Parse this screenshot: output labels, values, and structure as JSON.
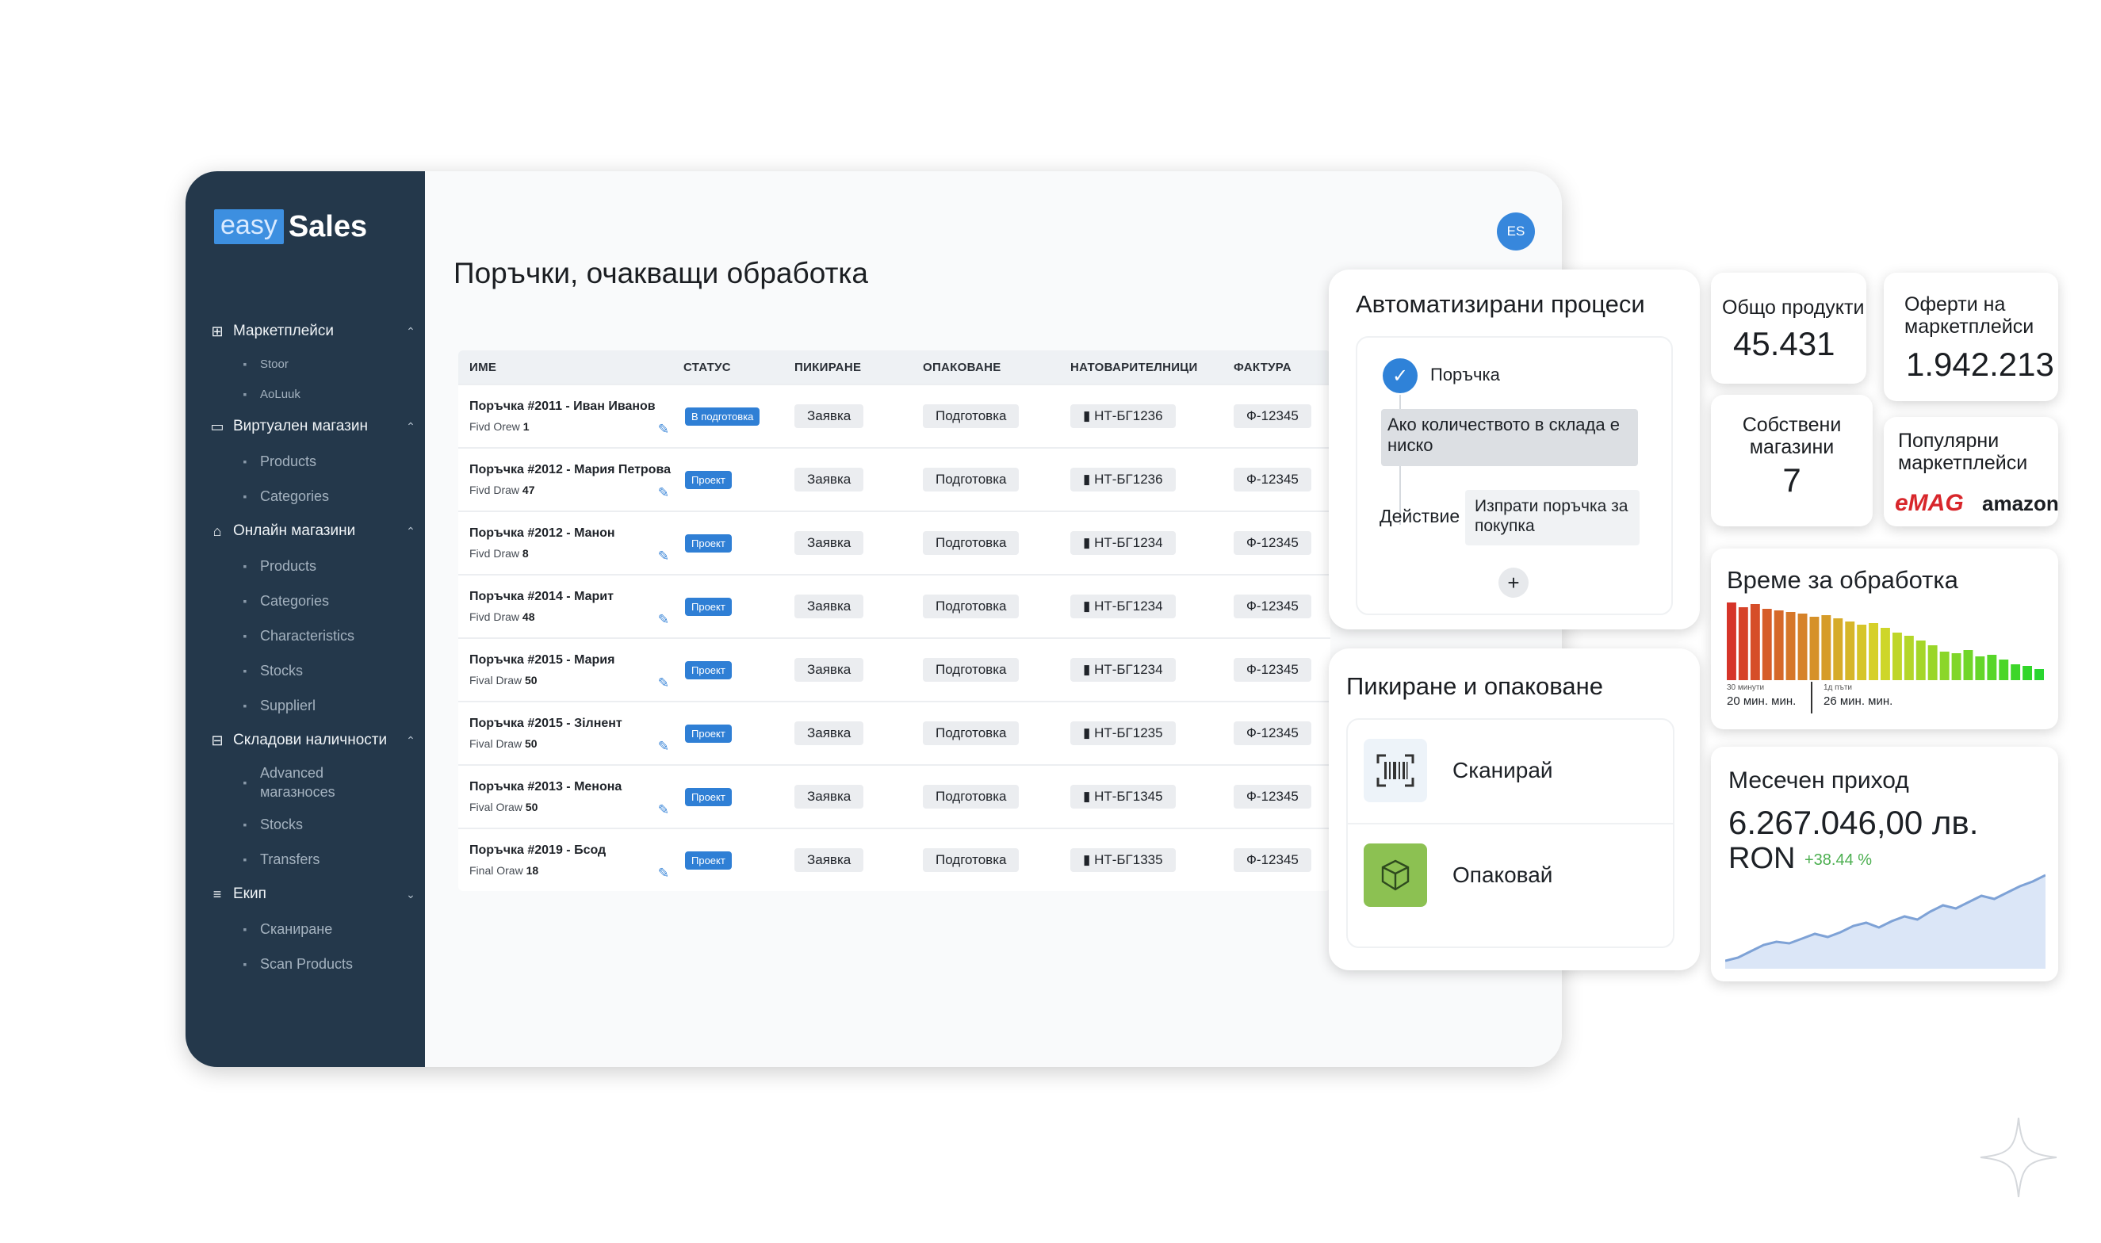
{
  "brand": {
    "easy": "easy",
    "sales": "Sales"
  },
  "user": {
    "initials": "ES"
  },
  "sidebar": {
    "groups": [
      {
        "icon": "marketplace-icon",
        "label": "Маркетплейси",
        "items": [
          {
            "icon": "stor-icon",
            "label": "Stoor"
          },
          {
            "icon": "aduuk-icon",
            "label": "AoLuuk"
          }
        ]
      },
      {
        "icon": "virtual-store-icon",
        "label": "Виртуален магазин",
        "items": [
          {
            "icon": "products-icon",
            "label": "Products"
          },
          {
            "icon": "categories-icon",
            "label": "Categories"
          }
        ]
      },
      {
        "icon": "online-store-icon",
        "label": "Онлайн магазини",
        "items": [
          {
            "icon": "cart-icon",
            "label": "Products"
          },
          {
            "icon": "categories-icon",
            "label": "Categories"
          },
          {
            "icon": "characteristics-icon",
            "label": "Characteristics"
          },
          {
            "icon": "stocks-icon",
            "label": "Stocks"
          },
          {
            "icon": "supplier-icon",
            "label": "Supplierl"
          }
        ]
      },
      {
        "icon": "warehouse-icon",
        "label": "Складови наличности",
        "items": [
          {
            "icon": "advanced-icon",
            "label": "Advanced магазносеs"
          },
          {
            "icon": "stocks-icon",
            "label": "Stocks"
          },
          {
            "icon": "transfers-icon",
            "label": "Transfers"
          }
        ]
      },
      {
        "icon": "team-icon",
        "label": "Екип",
        "items": [
          {
            "icon": "scan-icon",
            "label": "Сканиране"
          },
          {
            "icon": "scan-products-icon",
            "label": "Scan Products"
          }
        ]
      }
    ]
  },
  "main": {
    "title": "Поръчки, очакващи обработка",
    "columns": [
      "ИМЕ",
      "СТАТУС",
      "ПИКИРАНЕ",
      "ОПАКОВАНЕ",
      "НАТОВАРИТЕЛНИЦИ",
      "ФАКТУРА"
    ],
    "rows": [
      {
        "name": "Поръчка #2011 - Иван Иванов",
        "sub_label": "Fivd Orew",
        "sub_value": "1",
        "status": "В подготовка",
        "picking": "Заявка",
        "packing": "Подготовка",
        "waybill": "НТ-БГ1236",
        "invoice": "Ф-12345"
      },
      {
        "name": "Поръчка #2012 - Мария Петрова",
        "sub_label": "Fivd Draw",
        "sub_value": "47",
        "status": "Проект",
        "picking": "Заявка",
        "packing": "Подготовка",
        "waybill": "НТ-БГ1236",
        "invoice": "Ф-12345"
      },
      {
        "name": "Поръчка #2012 - Манон",
        "sub_label": "Fivd Draw",
        "sub_value": "8",
        "status": "Проект",
        "picking": "Заявка",
        "packing": "Подготовка",
        "waybill": "НТ-БГ1234",
        "invoice": "Ф-12345"
      },
      {
        "name": "Поръчка #2014 - Марит",
        "sub_label": "Fivd Draw",
        "sub_value": "48",
        "status": "Проект",
        "picking": "Заявка",
        "packing": "Подготовка",
        "waybill": "НТ-БГ1234",
        "invoice": "Ф-12345"
      },
      {
        "name": "Поръчка #2015 - Мария",
        "sub_label": "Fival Draw",
        "sub_value": "50",
        "status": "Проект",
        "picking": "Заявка",
        "packing": "Подготовка",
        "waybill": "НТ-БГ1234",
        "invoice": "Ф-12345"
      },
      {
        "name": "Поръчка #2015 - Зілнент",
        "sub_label": "Fival Draw",
        "sub_value": "50",
        "status": "Проект",
        "picking": "Заявка",
        "packing": "Подготовка",
        "waybill": "НТ-БГ1235",
        "invoice": "Ф-12345"
      },
      {
        "name": "Поръчка #2013 - Менона",
        "sub_label": "Fival Oraw",
        "sub_value": "50",
        "status": "Проект",
        "picking": "Заявка",
        "packing": "Подготовка",
        "waybill": "НТ-БГ1345",
        "invoice": "Ф-12345"
      },
      {
        "name": "Поръчка #2019 - Бсод",
        "sub_label": "Final Oraw",
        "sub_value": "18",
        "status": "Проект",
        "picking": "Заявка",
        "packing": "Подготовка",
        "waybill": "НТ-БГ1335",
        "invoice": "Ф-12345"
      }
    ]
  },
  "automation": {
    "title": "Автоматизирани процеси",
    "trigger": "Поръчка",
    "condition": "Ако количеството в склада е ниско",
    "action_label": "Действие",
    "action": "Изпрати поръчка за покупка",
    "add": "+"
  },
  "picking": {
    "title": "Пикиране и опаковане",
    "items": [
      {
        "icon": "barcode-scan-icon",
        "label": "Сканирай"
      },
      {
        "icon": "package-icon",
        "label": "Опаковай"
      }
    ]
  },
  "stats": {
    "total_products": {
      "label": "Общо продукти",
      "value": "45.431"
    },
    "offers": {
      "label": "Оферти на маркетплейси",
      "value": "1.942.213"
    },
    "own_stores": {
      "label": "Собствени магазини",
      "value": "7"
    },
    "popular": {
      "label": "Популярни маркетплейси",
      "emag": "eMAG",
      "amazon": "amazon"
    }
  },
  "processing": {
    "title": "Време за обработка",
    "left_small": "30 минути",
    "left_caption": "20 мин. мин.",
    "right_small": "1д пъти",
    "right_caption": "26 мин. мин.",
    "bars": [
      0.98,
      0.92,
      0.96,
      0.9,
      0.88,
      0.86,
      0.84,
      0.8,
      0.82,
      0.78,
      0.74,
      0.7,
      0.72,
      0.66,
      0.6,
      0.56,
      0.5,
      0.44,
      0.36,
      0.34,
      0.38,
      0.3,
      0.32,
      0.26,
      0.2,
      0.18,
      0.14
    ]
  },
  "revenue": {
    "title": "Месечен приход",
    "value": "6.267.046,00 лв.",
    "currency": "RON",
    "change": "+38.44 %",
    "series": [
      10,
      14,
      22,
      30,
      34,
      32,
      38,
      44,
      40,
      46,
      54,
      58,
      52,
      60,
      66,
      62,
      72,
      80,
      76,
      84,
      92,
      88,
      96,
      104,
      110,
      118
    ]
  },
  "colors": {
    "sidebar": "#24384b",
    "accent": "#2f7fd5",
    "positive": "#4caf50"
  }
}
